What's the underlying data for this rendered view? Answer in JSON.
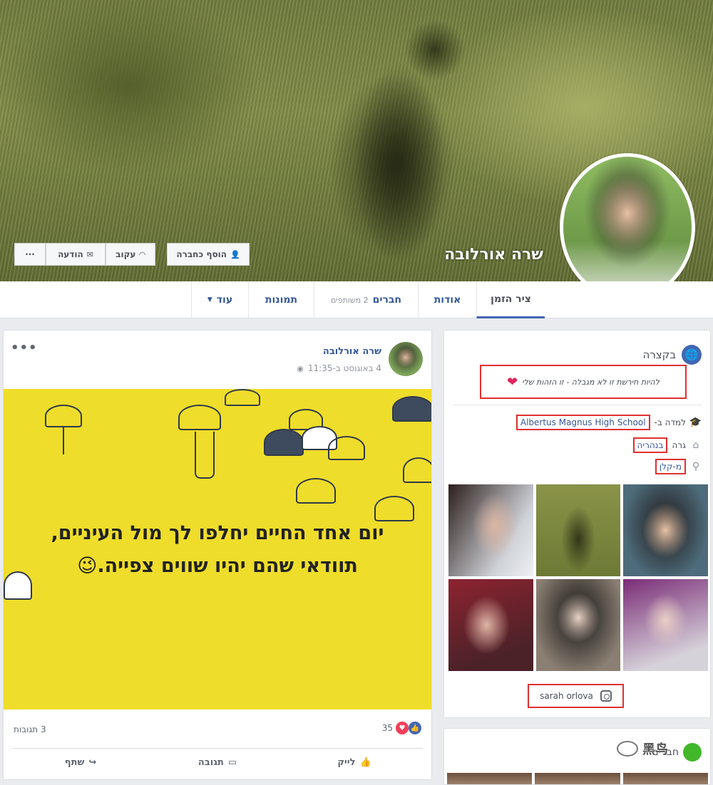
{
  "profile": {
    "name": "שרה אורלובה"
  },
  "cover_buttons": {
    "more": "···",
    "message": "הודעה",
    "follow": "עקוב",
    "add_friend": "הוסף כחברה"
  },
  "tabs": {
    "timeline": "ציר הזמן",
    "about": "אודות",
    "friends": "חברים",
    "friends_count": "2 משותפים",
    "photos": "תמונות",
    "more": "עוד"
  },
  "post": {
    "author": "שרה אורלובה",
    "time": "4 באוגוסט ב-11:35",
    "quote_line1": "יום אחד החיים יחלפו לך מול העיניים,",
    "quote_line2": "תוודאי שהם יהיו שווים צפייה.",
    "emoji": "😉",
    "reactions_count": "35",
    "comments_count": "3 תגובות",
    "like": "לייק",
    "comment": "תגובה",
    "share": "שתף"
  },
  "intro": {
    "title": "בקצרה",
    "bio": "להיות חירשת זו לא מגבלה - זו הזהות שלי",
    "studied_prefix": "למדה ב-",
    "school": "Albertus Magnus High School",
    "lives_prefix": "גרה",
    "city": "בנהריה",
    "from": "מ-קלן",
    "instagram": "sarah orlova"
  },
  "friends_card": {
    "title": "חברים"
  },
  "watermark": "黑鸟"
}
